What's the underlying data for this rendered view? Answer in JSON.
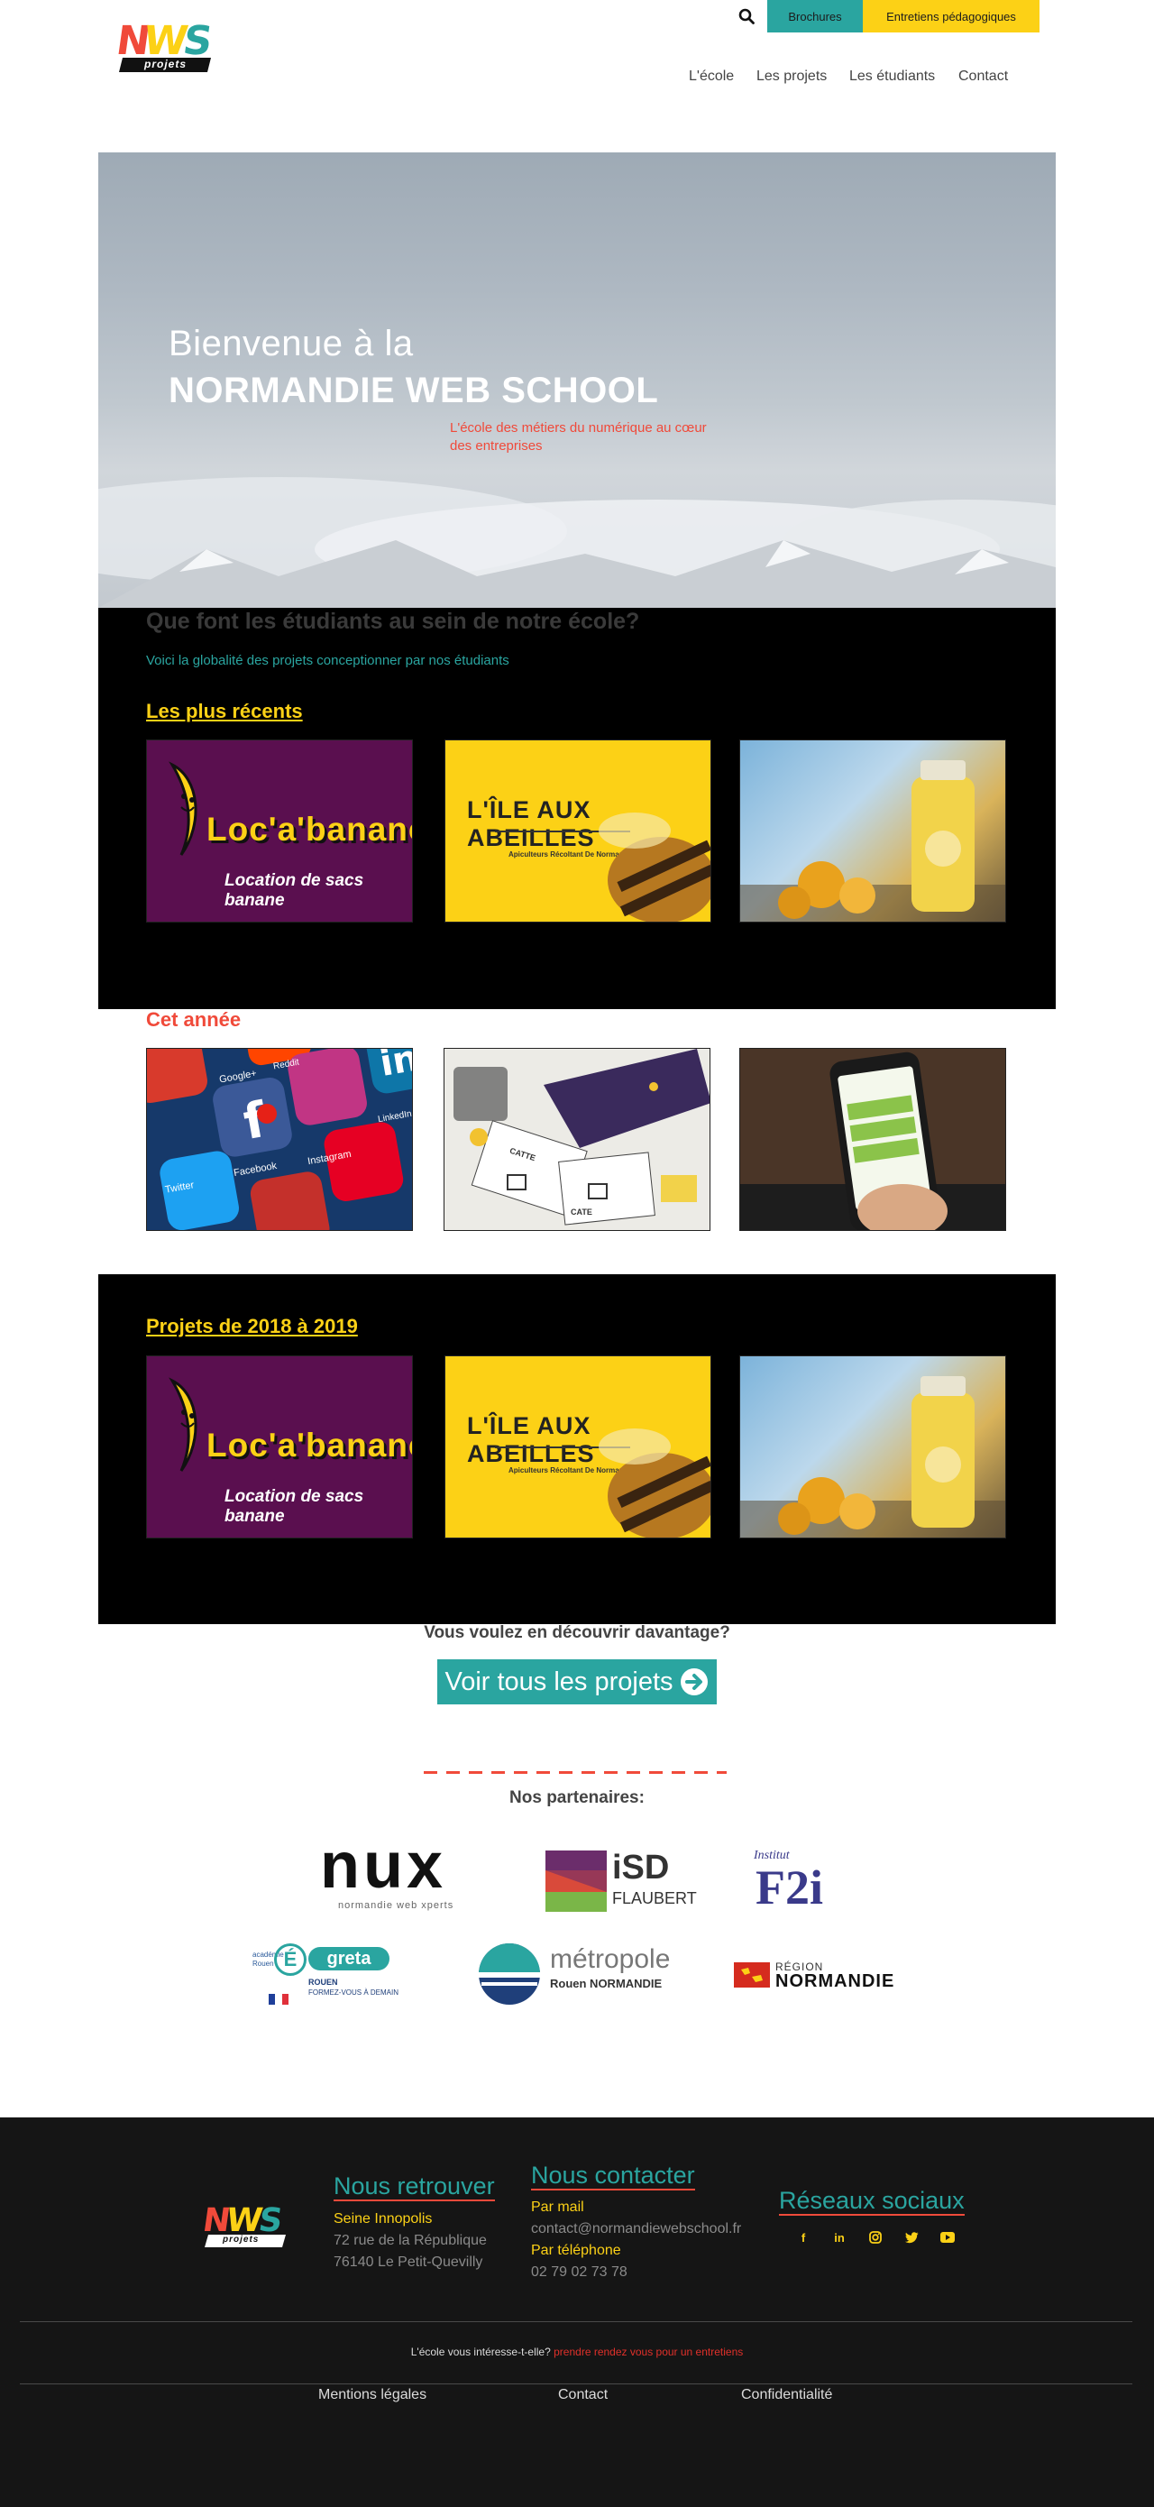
{
  "header": {
    "logo_text": "NWS",
    "logo_sub": "projets",
    "brochures_label": "Brochures",
    "entretiens_label": "Entretiens pédagogiques",
    "nav": [
      "L'école",
      "Les projets",
      "Les étudiants",
      "Contact"
    ]
  },
  "hero": {
    "line1": "Bienvenue à la",
    "line2": "NORMANDIE WEB SCHOOL",
    "subtitle": "L'école des métiers du numérique au cœur des entreprises"
  },
  "projects": {
    "title": "Que font les étudiants au sein de notre école?",
    "subtitle": "Voici la globalité des projets conceptionner par nos étudiants",
    "recent_heading": "Les plus récents",
    "year_heading": "Cet année",
    "archive_heading": "Projets de 2018 à 2019",
    "banana_title": "Loc'a'banane",
    "banana_sub": "Location de sacs banane",
    "bees_title": "L'ÎLE AUX ABEILLES",
    "bees_sub": "Apiculteurs Récoltant De Normandie",
    "social_labels": [
      "Google+",
      "Reddit",
      "Facebook",
      "Instagram",
      "LinkedIn",
      "Twitter"
    ],
    "sketch_labels": [
      "CATTE",
      "CATE"
    ]
  },
  "cta": {
    "question": "Vous voulez en découvrir davantage?",
    "button": "Voir tous les projets"
  },
  "partners": {
    "title": "Nos partenaires:",
    "nwx": "nux",
    "nwx_sub": "normandie web xperts",
    "isd": "iSD",
    "isd_sub": "FLAUBERT",
    "f2i_top": "Institut",
    "f2i": "F2i",
    "greta": "greta",
    "greta_left": "académie Rouen",
    "greta_sub1": "ROUEN",
    "greta_sub2": "FORMEZ-VOUS À DEMAIN",
    "metropole": "métropole",
    "metropole_sub": "Rouen NORMANDIE",
    "region_top": "RÉGION",
    "region": "NORMANDIE"
  },
  "footer": {
    "retrouver_heading": "Nous retrouver",
    "place": "Seine Innopolis",
    "address1": "72 rue de la République",
    "address2": "76140 Le Petit-Quevilly",
    "contact_heading": "Nous contacter",
    "mail_label": "Par mail",
    "email": "contact@normandiewebschool.fr",
    "phone_label": "Par téléphone",
    "phone": "02 79 02 73 78",
    "social_heading": "Réseaux sociaux",
    "interest_text": "L'école vous intéresse-t-elle?",
    "interest_link": "prendre rendez vous pour un entretiens",
    "links": [
      "Mentions légales",
      "Contact",
      "Confidentialité"
    ]
  },
  "colors": {
    "teal": "#2aa5a0",
    "yellow": "#fcd116",
    "red": "#f04a3a",
    "purple": "#5a0f4f"
  }
}
